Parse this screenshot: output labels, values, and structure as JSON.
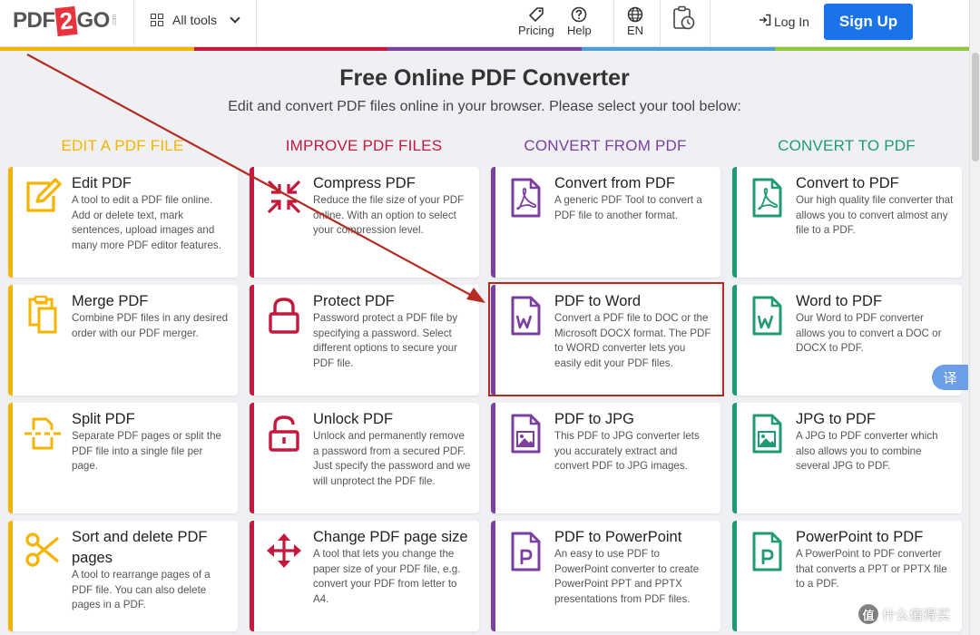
{
  "header": {
    "logo": {
      "left": "PDF",
      "mid": "2",
      "right": "GO",
      "suffix": ".com"
    },
    "all_tools": "All tools",
    "pricing": "Pricing",
    "help": "Help",
    "lang": "EN",
    "login": "Log In",
    "signup": "Sign Up"
  },
  "colors": {
    "edit": "#f5b400",
    "improve": "#c4183c",
    "convert_from": "#7b3fa0",
    "convert_to": "#1f9a74",
    "signup": "#1a73e8",
    "annotation": "#b52b22"
  },
  "hero": {
    "title": "Free Online PDF Converter",
    "subtitle": "Edit and convert PDF files online in your browser. Please select your tool below:"
  },
  "columns": [
    {
      "heading": "EDIT A PDF FILE",
      "cards": [
        {
          "title": "Edit PDF",
          "desc": "A tool to edit a PDF file online. Add or delete text, mark sentences, upload images and many more PDF editor features.",
          "icon": "edit-icon"
        },
        {
          "title": "Merge PDF",
          "desc": "Combine PDF files in any desired order with our PDF merger.",
          "icon": "merge-icon"
        },
        {
          "title": "Split PDF",
          "desc": "Separate PDF pages or split the PDF file into a single file per page.",
          "icon": "split-icon"
        },
        {
          "title": "Sort and delete PDF pages",
          "desc": "A tool to rearrange pages of a PDF file. You can also delete pages in a PDF.",
          "icon": "scissors-icon"
        }
      ]
    },
    {
      "heading": "IMPROVE PDF FILES",
      "cards": [
        {
          "title": "Compress PDF",
          "desc": "Reduce the file size of your PDF online. With an option to select your compression level.",
          "icon": "compress-icon"
        },
        {
          "title": "Protect PDF",
          "desc": "Password protect a PDF file by specifying a password. Select different options to secure your PDF file.",
          "icon": "lock-icon"
        },
        {
          "title": "Unlock PDF",
          "desc": "Unlock and permanently remove a password from a secured PDF. Just specify the password and we will unprotect the PDF file.",
          "icon": "unlock-icon"
        },
        {
          "title": "Change PDF page size",
          "desc": "A tool that lets you change the paper size of your PDF file, e.g. convert your PDF from letter to A4.",
          "icon": "resize-icon"
        }
      ]
    },
    {
      "heading": "CONVERT FROM PDF",
      "cards": [
        {
          "title": "Convert from PDF",
          "desc": "A generic PDF Tool to convert a PDF file to another format.",
          "icon": "pdf-file-icon"
        },
        {
          "title": "PDF to Word",
          "desc": "Convert a PDF file to DOC or the Microsoft DOCX format. The PDF to WORD converter lets you easily edit your PDF files.",
          "icon": "word-file-icon"
        },
        {
          "title": "PDF to JPG",
          "desc": "This PDF to JPG converter lets you accurately extract and convert PDF to JPG images.",
          "icon": "image-file-icon"
        },
        {
          "title": "PDF to PowerPoint",
          "desc": "An easy to use PDF to PowerPoint converter to create PowerPoint PPT and PPTX presentations from PDF files.",
          "icon": "powerpoint-file-icon"
        }
      ]
    },
    {
      "heading": "CONVERT TO PDF",
      "cards": [
        {
          "title": "Convert to PDF",
          "desc": "Our high quality file converter that allows you to convert almost any file to a PDF.",
          "icon": "pdf-file-icon"
        },
        {
          "title": "Word to PDF",
          "desc": "Our Word to PDF converter allows you to convert a DOC or DOCX to PDF.",
          "icon": "word-file-icon"
        },
        {
          "title": "JPG to PDF",
          "desc": "A JPG to PDF converter which also allows you to combine several JPG to PDF.",
          "icon": "image-file-icon"
        },
        {
          "title": "PowerPoint to PDF",
          "desc": "A PowerPoint to PDF converter that converts a PPT or PPTX file to a PDF.",
          "icon": "powerpoint-file-icon"
        }
      ]
    }
  ],
  "translate_label": "译",
  "watermark": "什么值得买",
  "watermark_badge": "值"
}
